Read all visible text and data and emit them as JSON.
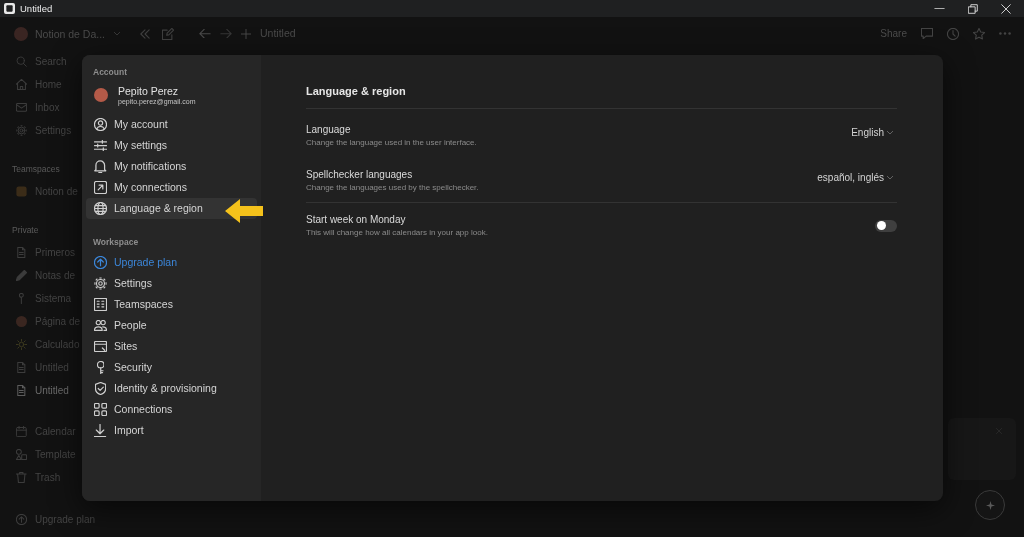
{
  "window": {
    "title": "Untitled"
  },
  "sidebar": {
    "workspace": "Notion de Da...",
    "top_items": [
      {
        "label": "Search",
        "selected": false
      },
      {
        "label": "Home",
        "selected": false
      },
      {
        "label": "Inbox",
        "selected": false
      },
      {
        "label": "Settings",
        "selected": false
      }
    ],
    "sections": [
      {
        "heading": "Teamspaces",
        "items": [
          {
            "label": "Notion de",
            "selected": false
          }
        ]
      },
      {
        "heading": "Private",
        "items": [
          {
            "label": "Primeros",
            "selected": false
          },
          {
            "label": "Notas de",
            "selected": false
          },
          {
            "label": "Sistema",
            "selected": false
          },
          {
            "label": "Página de",
            "selected": false
          },
          {
            "label": "Calculado",
            "selected": false
          },
          {
            "label": "Untitled",
            "selected": false
          },
          {
            "label": "Untitled",
            "selected": true
          }
        ]
      }
    ],
    "bottom_items": [
      {
        "label": "Calendar",
        "selected": false
      },
      {
        "label": "Template",
        "selected": false
      },
      {
        "label": "Trash",
        "selected": false
      }
    ],
    "upgrade": "Upgrade plan"
  },
  "topbar": {
    "breadcrumb": "Untitled",
    "share": "Share"
  },
  "settings_modal": {
    "nav": [
      {
        "heading": "Account",
        "user": {
          "name": "Pepito Perez",
          "email": "pepito.perez@gmail.com"
        },
        "items": [
          {
            "label": "My account",
            "kind": "page",
            "selected": false
          },
          {
            "label": "My settings",
            "kind": "page",
            "selected": false
          },
          {
            "label": "My notifications",
            "kind": "page",
            "selected": false
          },
          {
            "label": "My connections",
            "kind": "page",
            "selected": false
          },
          {
            "label": "Language & region",
            "kind": "page",
            "selected": true
          }
        ]
      },
      {
        "heading": "Workspace",
        "items": [
          {
            "label": "Upgrade plan",
            "kind": "upgrade",
            "selected": false
          },
          {
            "label": "Settings",
            "kind": "page",
            "selected": false
          },
          {
            "label": "Teamspaces",
            "kind": "page",
            "selected": false
          },
          {
            "label": "People",
            "kind": "page",
            "selected": false
          },
          {
            "label": "Sites",
            "kind": "page",
            "selected": false
          },
          {
            "label": "Security",
            "kind": "page",
            "selected": false
          },
          {
            "label": "Identity & provisioning",
            "kind": "page",
            "selected": false
          },
          {
            "label": "Connections",
            "kind": "page",
            "selected": false
          },
          {
            "label": "Import",
            "kind": "page",
            "selected": false
          }
        ]
      }
    ],
    "page": {
      "title": "Language & region",
      "groups": [
        {
          "rows": [
            {
              "kind": "dropdown",
              "label": "Language",
              "description": "Change the language used in the user interface.",
              "value": "English"
            },
            {
              "kind": "dropdown",
              "label": "Spellchecker languages",
              "description": "Change the languages used by the spellchecker.",
              "value": "español, inglés"
            }
          ]
        },
        {
          "rows": [
            {
              "kind": "toggle",
              "label": "Start week on Monday",
              "description": "This will change how all calendars in your app look.",
              "on": false
            }
          ]
        }
      ]
    }
  }
}
